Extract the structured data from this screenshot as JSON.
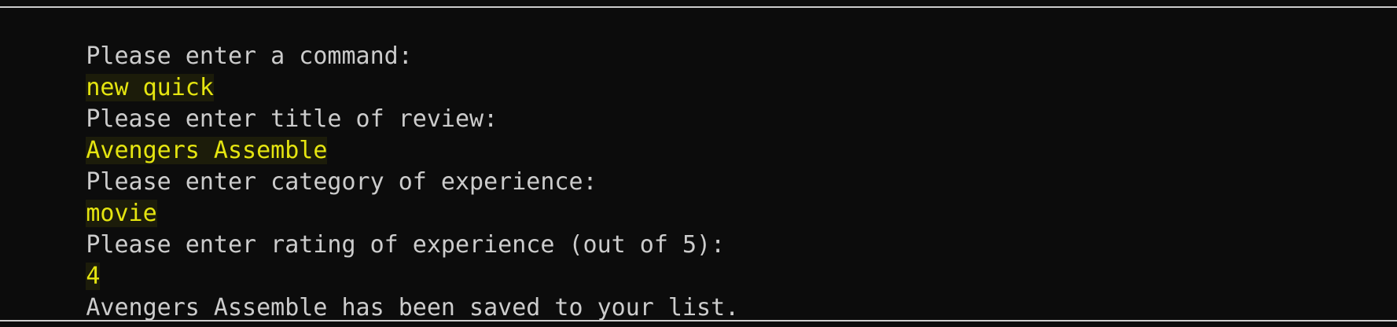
{
  "terminal": {
    "lines": [
      {
        "kind": "prompt",
        "text": "Please enter a command:"
      },
      {
        "kind": "input",
        "text": "new quick"
      },
      {
        "kind": "prompt",
        "text": "Please enter title of review:"
      },
      {
        "kind": "input",
        "text": "Avengers Assemble"
      },
      {
        "kind": "prompt",
        "text": "Please enter category of experience:"
      },
      {
        "kind": "input",
        "text": "movie"
      },
      {
        "kind": "prompt",
        "text": "Please enter rating of experience (out of 5):"
      },
      {
        "kind": "input",
        "text": "4"
      },
      {
        "kind": "output",
        "text": "Avengers Assemble has been saved to your list."
      }
    ]
  },
  "colors": {
    "background": "#0c0c0c",
    "text": "#cccccc",
    "user_input": "#e5e510"
  }
}
